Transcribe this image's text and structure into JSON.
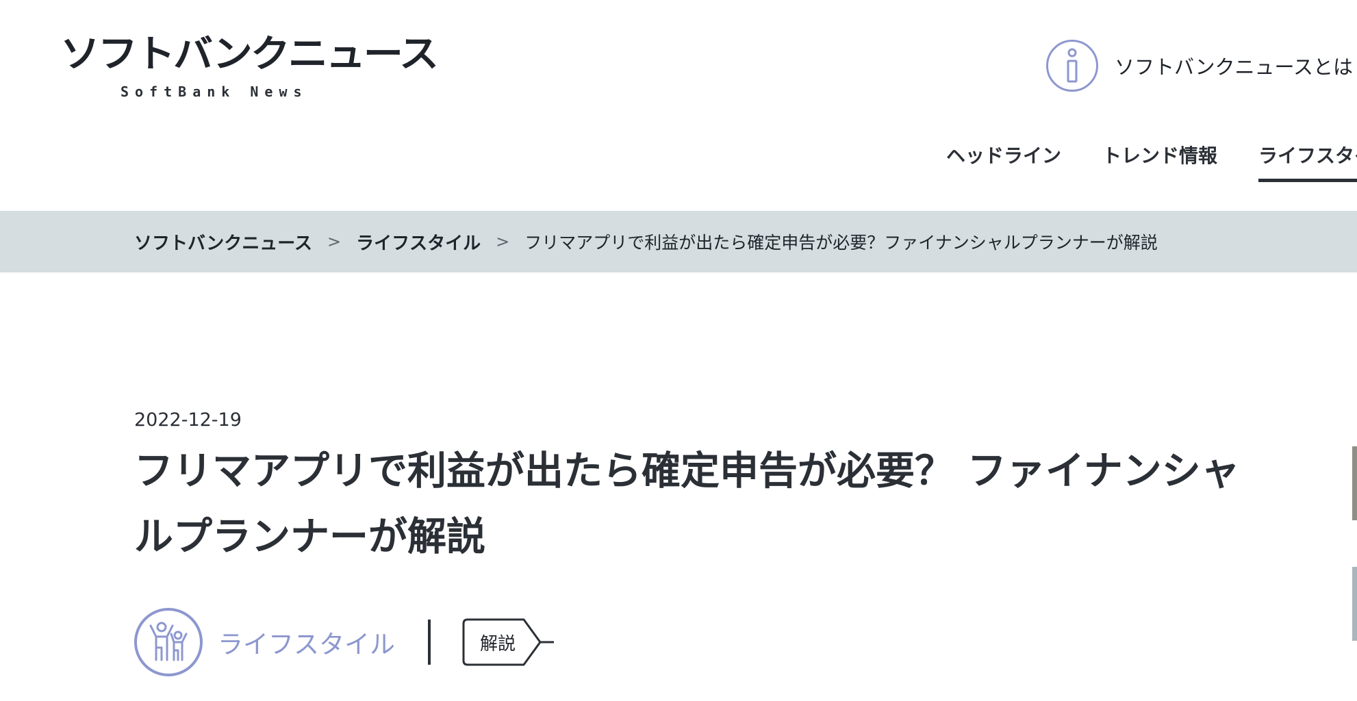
{
  "header": {
    "logo_ja": "ソフトバンクニュース",
    "logo_en": "SoftBank News",
    "about_link": "ソフトバンクニュースとは",
    "about_icon": "info-icon"
  },
  "nav": {
    "items": [
      "ヘッドライン",
      "トレンド情報",
      "ライフスタイル"
    ],
    "active": "ライフスタイル"
  },
  "breadcrumb": {
    "items": [
      "ソフトバンクニュース",
      "ライフスタイル"
    ],
    "separator": ">",
    "current": "フリマアプリで利益が出たら確定申告が必要？ファイナンシャルプランナーが解説"
  },
  "article": {
    "date": "2022-12-19",
    "title": "フリマアプリで利益が出たら確定申告が必要？ ファイナンシャルプランナーが解説",
    "category": "ライフスタイル",
    "category_icon": "family-icon",
    "tag": "解説"
  },
  "colors": {
    "accent": "#8d97cf",
    "text": "#2b2f36",
    "breadcrumb_bg": "#d5dde0"
  }
}
